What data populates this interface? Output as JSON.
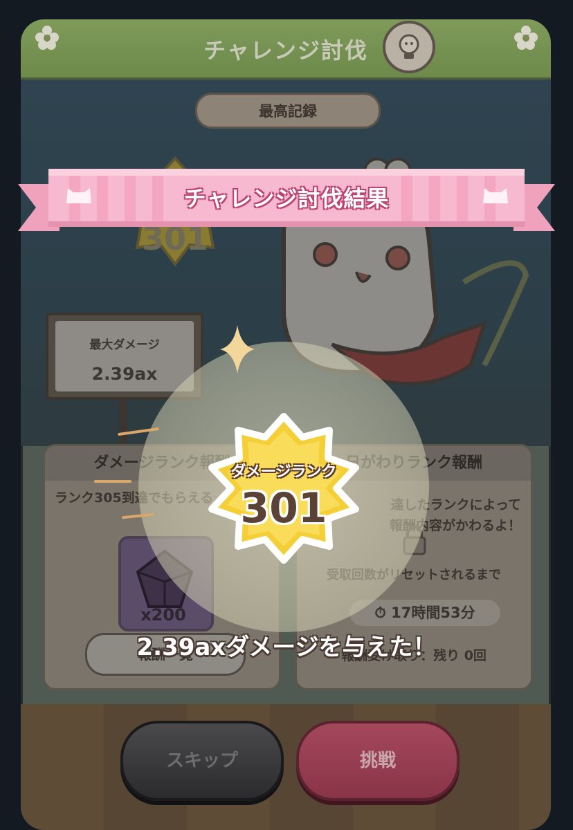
{
  "panel": {
    "title": "チャレンジ討伐",
    "best_record_label": "最高記録",
    "best_rank_badge": "301",
    "max_damage_label": "最大ダメージ",
    "max_damage_value": "2.39ax"
  },
  "cards": {
    "left": {
      "title": "ダメージランク報酬",
      "subtitle": "ランク305到達でもらえる",
      "reward_count": "x200",
      "list_button": "報酬一覧"
    },
    "right": {
      "title": "日がわりランク報酬",
      "note_line1": "達したランクによって",
      "note_line2": "報酬内容がかわるよ！",
      "reset_label": "受取回数がリセットされるまで",
      "timer": "17時間53分",
      "remaining": "報酬受け取り：残り 0回"
    }
  },
  "buttons": {
    "skip": "スキップ",
    "challenge": "挑戦"
  },
  "result": {
    "banner_title": "チャレンジ討伐結果",
    "rank_label": "ダメージランク",
    "rank_value": "301",
    "damage_message": "2.39axダメージを与えた！"
  },
  "colors": {
    "ribbon_pink": "#f7b9cf",
    "badge_gold": "#f4cf37",
    "challenge_red": "#a4485c"
  },
  "icons": [
    "flower-icon",
    "lightbulb-icon",
    "sword-icon",
    "gem-icon",
    "lock-icon",
    "clock-icon",
    "cat-face-icon",
    "sparkle-icon"
  ]
}
